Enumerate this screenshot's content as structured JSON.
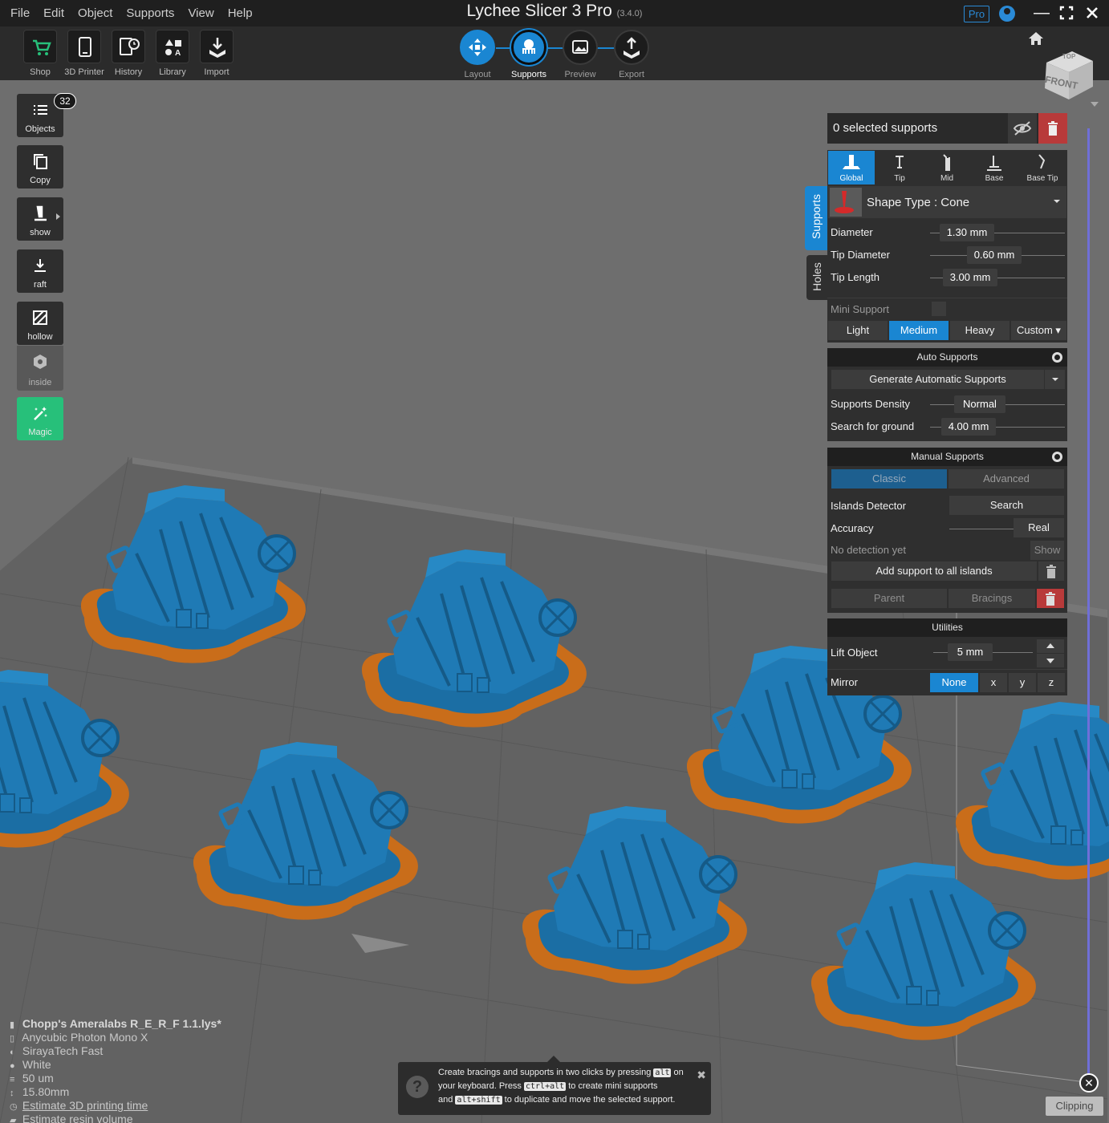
{
  "menu": [
    "File",
    "Edit",
    "Object",
    "Supports",
    "View",
    "Help"
  ],
  "app": {
    "title": "Lychee Slicer 3 Pro",
    "version": "(3.4.0)",
    "pro_badge": "Pro"
  },
  "toolbar": {
    "left": [
      {
        "label": "Shop",
        "icon": "cart-icon"
      },
      {
        "label": "3D Printer",
        "icon": "phone-printer-icon"
      },
      {
        "label": "History",
        "icon": "history-icon"
      },
      {
        "label": "Library",
        "icon": "library-icon"
      },
      {
        "label": "Import",
        "icon": "import-icon"
      }
    ],
    "steps": [
      {
        "label": "Layout",
        "icon": "layout-icon"
      },
      {
        "label": "Supports",
        "icon": "supports-icon"
      },
      {
        "label": "Preview",
        "icon": "preview-icon"
      },
      {
        "label": "Export",
        "icon": "export-icon"
      }
    ]
  },
  "viewcube": {
    "top": "TOP",
    "front": "FRONT"
  },
  "left_tools": {
    "objects_count": "32",
    "items": [
      {
        "label": "Objects",
        "icon": "list-icon"
      },
      {
        "label": "Copy",
        "icon": "copy-icon"
      },
      {
        "label": "show",
        "icon": "support-show-icon"
      },
      {
        "label": "raft",
        "icon": "raft-icon"
      },
      {
        "label": "hollow",
        "icon": "hollow-icon"
      },
      {
        "label": "inside",
        "icon": "inside-icon"
      },
      {
        "label": "Magic",
        "icon": "magic-wand-icon"
      }
    ]
  },
  "side_tabs": [
    "Supports",
    "Holes"
  ],
  "supports_panel": {
    "selected": "0 selected supports",
    "types": [
      "Global",
      "Tip",
      "Mid",
      "Base",
      "Base Tip"
    ],
    "shape_type": "Shape Type : Cone",
    "params": [
      {
        "label": "Diameter",
        "value": "1.30 mm"
      },
      {
        "label": "Tip Diameter",
        "value": "0.60 mm"
      },
      {
        "label": "Tip Length",
        "value": "3.00 mm"
      }
    ],
    "mini_support": "Mini Support",
    "presets": [
      "Light",
      "Medium",
      "Heavy",
      "Custom ▾"
    ],
    "active_preset": "Medium"
  },
  "auto_supports": {
    "title": "Auto Supports",
    "generate": "Generate Automatic Supports",
    "density_label": "Supports Density",
    "density_value": "Normal",
    "ground_label": "Search for ground",
    "ground_value": "4.00 mm"
  },
  "manual_supports": {
    "title": "Manual Supports",
    "tabs": [
      "Classic",
      "Advanced"
    ],
    "islands_label": "Islands Detector",
    "search": "Search",
    "accuracy_label": "Accuracy",
    "accuracy_value": "Real",
    "no_detection": "No detection yet",
    "show": "Show",
    "add_all": "Add support to all islands",
    "parent": "Parent",
    "bracings": "Bracings"
  },
  "utilities": {
    "title": "Utilities",
    "lift_label": "Lift Object",
    "lift_value": "5 mm",
    "mirror_label": "Mirror",
    "mirror_options": [
      "None",
      "x",
      "y",
      "z"
    ]
  },
  "file_info": {
    "name": "Chopp's Ameralabs R_E_R_F 1.1.lys*",
    "printer": "Anycubic Photon Mono X",
    "resin": "SirayaTech Fast",
    "color": "White",
    "layer": "50 um",
    "height": "15.80mm",
    "estimate_time": "Estimate 3D printing time",
    "estimate_volume": "Estimate resin volume"
  },
  "tip": {
    "part1": "Create bracings and supports in two clicks by pressing",
    "key1": "alt",
    "part2": "on your keyboard. Press",
    "key2": "ctrl+alt",
    "part3": "to create mini supports",
    "part4": "and",
    "key3": "alt+shift",
    "part5": "to duplicate and move the selected support."
  },
  "clipping": "Clipping",
  "colors": {
    "accent": "#1a86d2",
    "model": "#1f78b0",
    "raft": "#c96d1a",
    "magic": "#27c07a",
    "danger": "#b83a3a"
  }
}
